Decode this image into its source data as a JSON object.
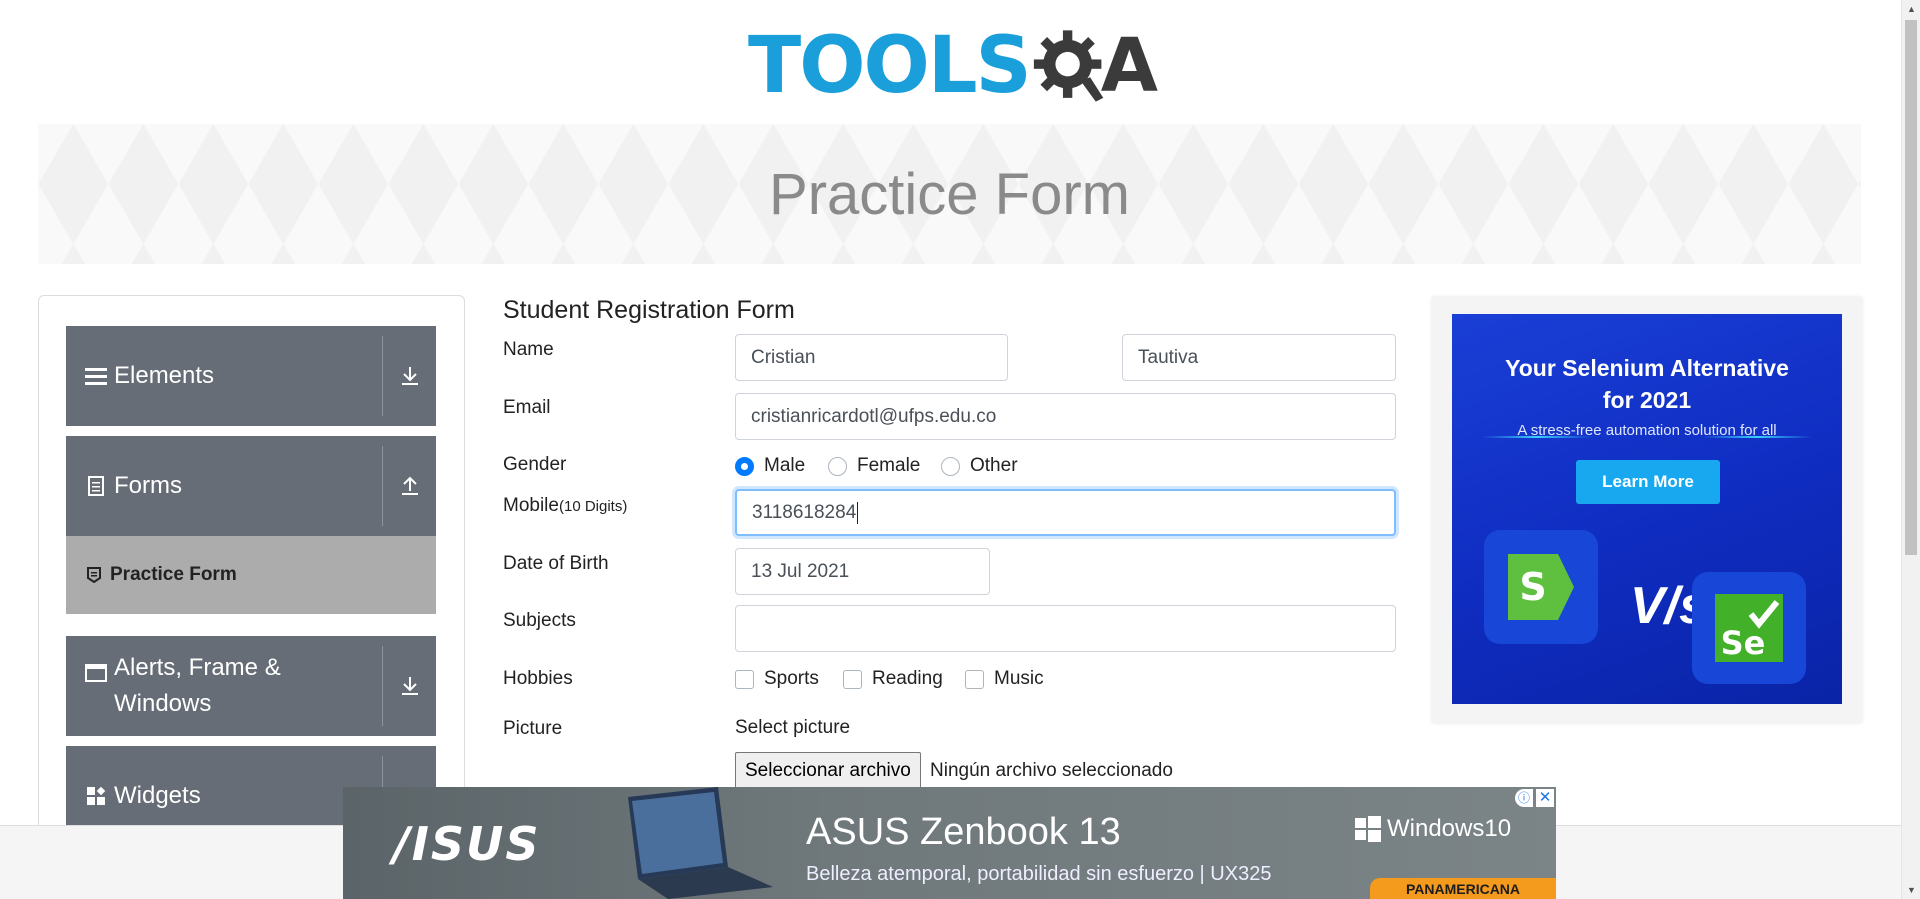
{
  "logo": {
    "text": "TOOLS",
    "letter": "A"
  },
  "banner": {
    "title": "Practice Form"
  },
  "sidebar": {
    "groups": [
      {
        "label": "Elements",
        "icon": "hamburger-icon",
        "toggle": "download-arrow-icon"
      },
      {
        "label": "Forms",
        "icon": "document-icon",
        "toggle": "upload-arrow-icon"
      },
      {
        "label": "Alerts, Frame & Windows",
        "icon": "window-icon",
        "toggle": "download-arrow-icon"
      },
      {
        "label": "Widgets",
        "icon": "widgets-icon",
        "toggle": "download-arrow-icon"
      }
    ],
    "active_item": {
      "label": "Practice Form",
      "icon": "form-icon"
    }
  },
  "form": {
    "title": "Student Registration Form",
    "labels": {
      "name": "Name",
      "email": "Email",
      "gender": "Gender",
      "mobile": "Mobile",
      "mobile_hint": "(10 Digits)",
      "dob": "Date of Birth",
      "subjects": "Subjects",
      "hobbies": "Hobbies",
      "picture": "Picture"
    },
    "first_name": "Cristian",
    "last_name": "Tautiva",
    "email": "cristianricardotl@ufps.edu.co",
    "gender_options": [
      "Male",
      "Female",
      "Other"
    ],
    "gender_selected": "Male",
    "mobile": "3118618284",
    "dob": "13 Jul 2021",
    "subjects": "",
    "hobbies": [
      "Sports",
      "Reading",
      "Music"
    ],
    "select_picture_label": "Select picture",
    "file_button": "Seleccionar archivo",
    "file_status": "Ningún archivo seleccionado"
  },
  "right_ad": {
    "title_line1": "Your Selenium Alternative",
    "title_line2": "for 2021",
    "subtitle": "A stress-free automation solution for all",
    "button": "Learn More",
    "vs": "V/s",
    "logo_right": "Se"
  },
  "bottom_ad": {
    "brand": "/ISUS",
    "title": "ASUS Zenbook 13",
    "subtitle": "Belleza atemporal, portabilidad sin esfuerzo  | UX325",
    "windows": "Windows10",
    "retailer": "PANAMERICANA",
    "close": "✕",
    "info": "ⓘ"
  },
  "colors": {
    "sidebar_group": "#666d76",
    "active_item": "#acacac",
    "logo_blue": "#1a9fdb",
    "radio_checked": "#007bff",
    "ad_blue": "#1a3fd6"
  }
}
